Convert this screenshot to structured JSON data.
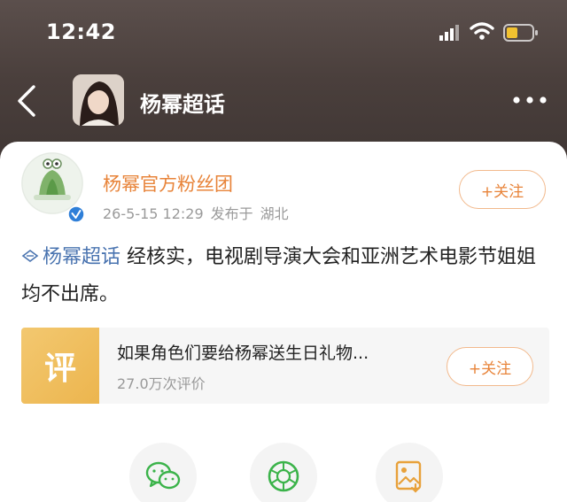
{
  "status_bar": {
    "time": "12:42"
  },
  "nav": {
    "title": "杨幂超话"
  },
  "post": {
    "author": "杨幂官方粉丝团",
    "date": "26-5-15 12:29",
    "location_prefix": "发布于",
    "location": "湖北",
    "follow_label": "+关注",
    "topic": "杨幂超话",
    "text": "经核实，电视剧导演大会和亚洲艺术电影节姐姐均不出席。"
  },
  "review": {
    "badge": "评",
    "title": "如果角色们要给杨幂送生日礼物...",
    "count": "27.0万次评价",
    "follow_label": "+关注"
  },
  "colors": {
    "accent": "#e8843a",
    "topic": "#4a74b0",
    "wechat": "#3bb34a",
    "moments": "#3bb34a",
    "save": "#e8a13a"
  }
}
